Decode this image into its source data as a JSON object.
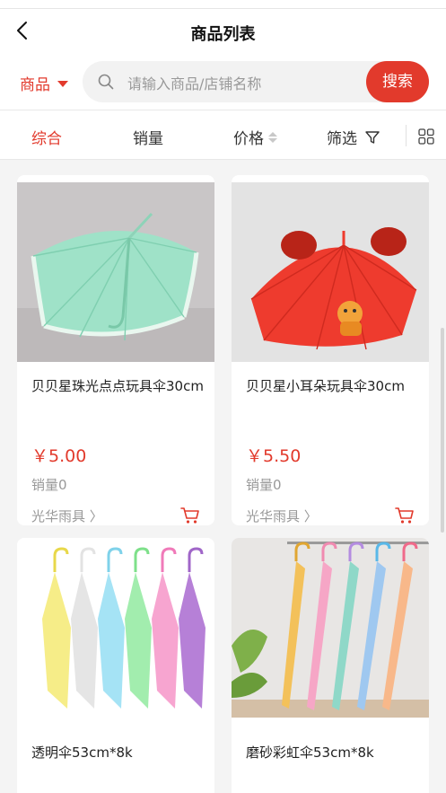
{
  "header": {
    "title": "商品列表"
  },
  "search": {
    "category_label": "商品",
    "placeholder": "请输入商品/店铺名称",
    "button_label": "搜索"
  },
  "filters": {
    "comprehensive": "综合",
    "sales": "销量",
    "price": "价格",
    "filter": "筛选"
  },
  "products": [
    {
      "name": "贝贝星珠光点点玩具伞30cm",
      "price": "￥5.00",
      "sales": "销量0",
      "shop": "光华雨具",
      "image": "mint umbrella"
    },
    {
      "name": "贝贝星小耳朵玩具伞30cm",
      "price": "￥5.50",
      "sales": "销量0",
      "shop": "光华雨具",
      "image": "red umbrella with ears"
    },
    {
      "name": "透明伞53cm*8k",
      "image": "colorful transparent umbrellas"
    },
    {
      "name": "磨砂彩虹伞53cm*8k",
      "image": "rainbow frosted umbrellas"
    }
  ],
  "colors": {
    "accent": "#e23a2c",
    "muted": "#999999"
  }
}
